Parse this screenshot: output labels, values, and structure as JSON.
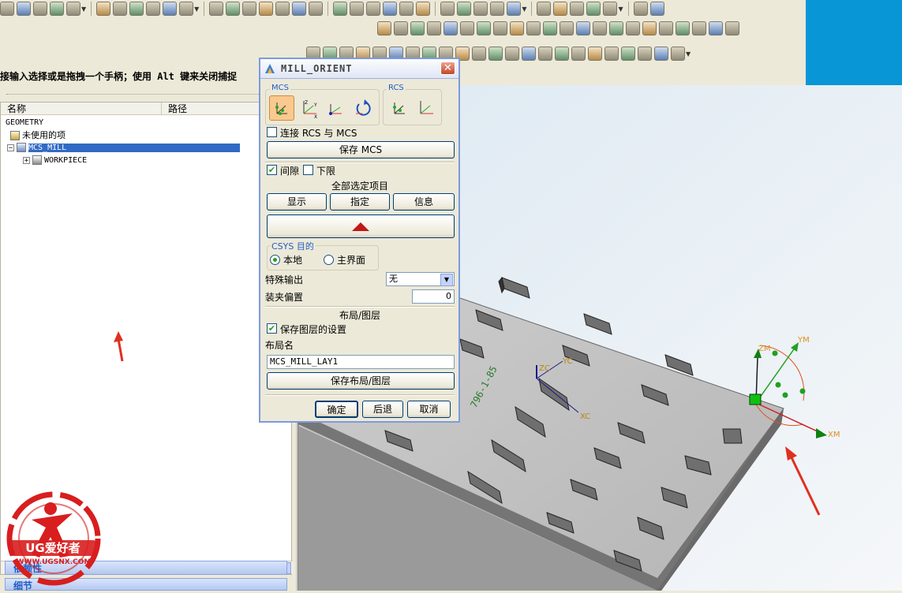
{
  "navigator": {
    "hint": "接输入选择或是拖拽一个手柄；使用 Alt 键来关闭捕捉",
    "columns": [
      "名称",
      "路径"
    ],
    "tree": [
      {
        "label": "GEOMETRY"
      },
      {
        "label": "未使用的项"
      },
      {
        "label": "MCS_MILL"
      },
      {
        "label": "WORKPIECE"
      }
    ],
    "panels": [
      "依赖性",
      "细节"
    ]
  },
  "dialog": {
    "title": "MILL_ORIENT",
    "mcs_group": "MCS",
    "rcs_group": "RCS",
    "link_label": "连接 RCS 与 MCS",
    "save_mcs": "保存 MCS",
    "clearance_label": "间隙",
    "clearance_checked": true,
    "lower_limit_label": "下限",
    "lower_limit_checked": false,
    "select_all_label": "全部选定项目",
    "display_btn": "显示",
    "specify_btn": "指定",
    "info_btn": "信息",
    "csys_group": "CSYS 目的",
    "local_label": "本地",
    "main_label": "主界面",
    "special_output_label": "特殊输出",
    "special_output_value": "无",
    "fixture_offset_label": "装夹偏置",
    "fixture_offset_value": "0",
    "layout_layer_label": "布局/图层",
    "save_layer_label": "保存图层的设置",
    "save_layer_checked": true,
    "layout_name_label": "布局名",
    "layout_name_value": "MCS_MILL_LAY1",
    "save_layout_btn": "保存布局/图层",
    "ok_btn": "确定",
    "back_btn": "后退",
    "cancel_btn": "取消"
  },
  "graphics": {
    "part_label": "796-1-85",
    "axes": [
      "ZC",
      "YC",
      "XC",
      "ZM",
      "YM",
      "XM"
    ]
  },
  "watermark": {
    "brand": "UG爱好者",
    "url": "WWW.UGSNX.COM"
  }
}
